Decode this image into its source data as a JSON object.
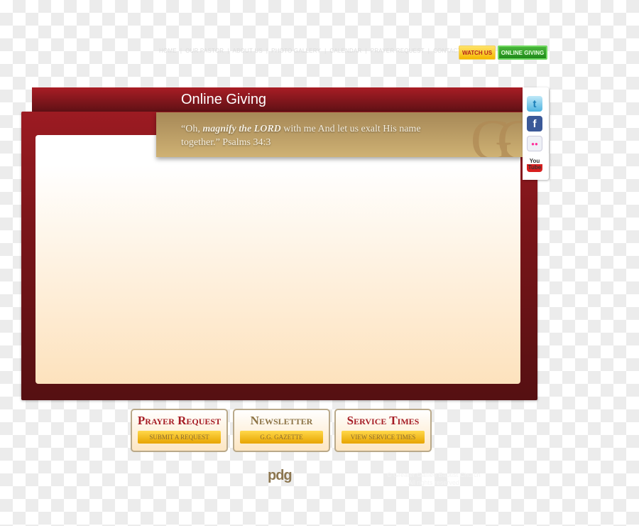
{
  "nav": {
    "items": [
      "HOME",
      "OUR PASTOR",
      "ABOUT US",
      "PHOTO GALLERY",
      "CALENDAR",
      "PRAYER REQUEST",
      "CONTACT"
    ],
    "watch_us": "WATCH US",
    "online_giving": "ONLINE GIVING"
  },
  "page": {
    "title": "Online Giving"
  },
  "quote": {
    "open": "“Oh, ",
    "emphasis": "magnify the LORD",
    "rest": " with me And let us exalt His name together.” Psalms 34:3",
    "monogram": "GG"
  },
  "social": [
    {
      "name": "twitter",
      "glyph": "t"
    },
    {
      "name": "facebook",
      "glyph": "f"
    },
    {
      "name": "flickr",
      "glyph": "●●"
    },
    {
      "name": "youtube",
      "glyph": "You Tube"
    }
  ],
  "boxes": [
    {
      "title": "Prayer Request",
      "button": "SUBMIT A REQUEST",
      "color": "#a51c24"
    },
    {
      "title": "Newsletter",
      "button": "G.G. GAZETTE",
      "color": "#8c7345"
    },
    {
      "title": "Service Times",
      "button": "VIEW SERVICE TIMES",
      "color": "#a51c24"
    }
  ],
  "footer": {
    "logo": "pdg",
    "copyright": "© Greater Galilee Baptist Church",
    "rights": "All rights reserved"
  }
}
